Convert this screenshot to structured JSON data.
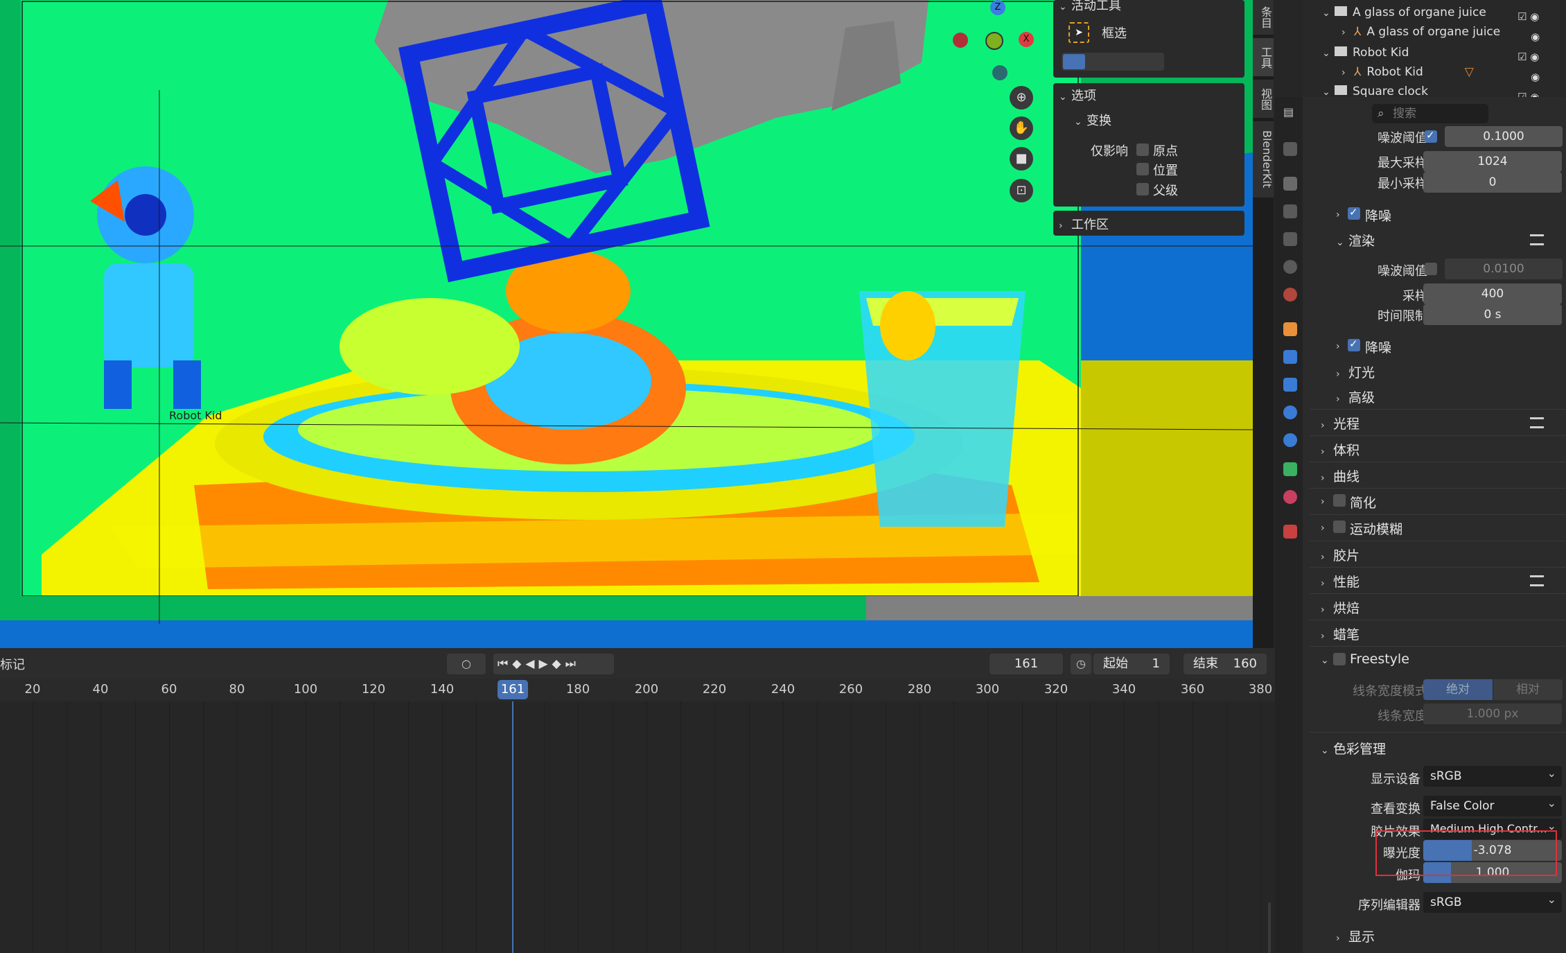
{
  "viewport": {
    "object_label": "Robot Kid",
    "gizmo": {
      "z": "Z",
      "x": "X"
    }
  },
  "npanel": {
    "active_tool_header": "活动工具",
    "box_select": "框选",
    "options_header": "选项",
    "transform_header": "变换",
    "affect_only": "仅影响",
    "origin": "原点",
    "location": "位置",
    "parent": "父级",
    "workspace_header": "工作区"
  },
  "sidebar_tabs": [
    "条目",
    "工具",
    "视图",
    "BlenderKit"
  ],
  "timeline": {
    "markers_label": "标记",
    "current_frame": "161",
    "start_label": "起始",
    "start_value": "1",
    "end_label": "结束",
    "end_value": "160",
    "ticks": [
      "20",
      "40",
      "60",
      "80",
      "100",
      "120",
      "140",
      "161",
      "180",
      "200",
      "220",
      "240",
      "260",
      "280",
      "300",
      "320",
      "340",
      "360",
      "380"
    ],
    "playhead_label": "161"
  },
  "outliner": {
    "rows": [
      {
        "label": "A glass of organe juice",
        "level": 1
      },
      {
        "label": "A glass of organe juice",
        "level": 2
      },
      {
        "label": "Robot Kid",
        "level": 1
      },
      {
        "label": "Robot Kid",
        "level": 2
      },
      {
        "label": "Square clock",
        "level": 1
      }
    ]
  },
  "properties": {
    "search_placeholder": "搜索",
    "noise_threshold_label": "噪波阈值",
    "noise_threshold_value": "0.1000",
    "max_samples_label": "最大采样",
    "max_samples_value": "1024",
    "min_samples_label": "最小采样",
    "min_samples_value": "0",
    "denoise_label": "降噪",
    "render_header": "渲染",
    "render_noise_threshold_label": "噪波阈值",
    "render_noise_threshold_value": "0.0100",
    "samples_label": "采样",
    "samples_value": "400",
    "time_limit_label": "时间限制",
    "time_limit_value": "0 s",
    "render_denoise_label": "降噪",
    "lights_label": "灯光",
    "advanced_label": "高级",
    "sections": [
      "光程",
      "体积",
      "曲线",
      "简化",
      "运动模糊",
      "胶片",
      "性能",
      "烘焙",
      "蜡笔"
    ],
    "freestyle_header": "Freestyle",
    "line_width_mode_label": "线条宽度模式",
    "absolute": "绝对",
    "relative": "相对",
    "line_width_label": "线条宽度",
    "line_width_value": "1.000 px",
    "color_management_header": "色彩管理",
    "display_device_label": "显示设备",
    "display_device_value": "sRGB",
    "view_transform_label": "查看变换",
    "view_transform_value": "False Color",
    "look_label": "胶片效果",
    "look_value": "Medium High Contr...",
    "exposure_label": "曝光度",
    "exposure_value": "-3.078",
    "exposure_fill": 0.35,
    "gamma_label": "伽玛",
    "gamma_value": "1.000",
    "gamma_fill": 0.2,
    "sequencer_label": "序列编辑器",
    "sequencer_value": "sRGB",
    "display_label": "显示"
  },
  "colors": {
    "accent": "#4772b3",
    "highlight_box": "#e0303a"
  }
}
